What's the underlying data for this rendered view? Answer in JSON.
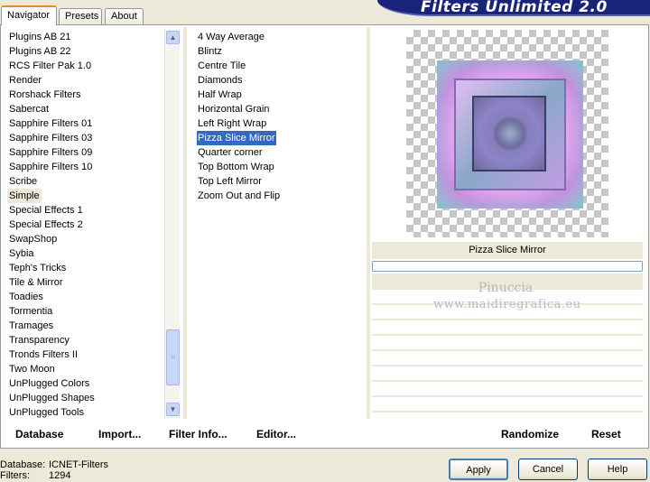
{
  "tabs": [
    "Navigator",
    "Presets",
    "About"
  ],
  "banner_title": "Filters Unlimited 2.0",
  "categories": [
    "Plugins AB 21",
    "Plugins AB 22",
    "RCS Filter Pak 1.0",
    "Render",
    "Rorshack Filters",
    "Sabercat",
    "Sapphire Filters 01",
    "Sapphire Filters 03",
    "Sapphire Filters 09",
    "Sapphire Filters 10",
    "Scribe",
    "Simple",
    "Special Effects 1",
    "Special Effects 2",
    "SwapShop",
    "Sybia",
    "Teph's Tricks",
    "Tile & Mirror",
    "Toadies",
    "Tormentia",
    "Tramages",
    "Transparency",
    "Tronds Filters II",
    "Two Moon",
    "UnPlugged Colors",
    "UnPlugged Shapes",
    "UnPlugged Tools"
  ],
  "selected_category": "Simple",
  "filters": [
    "4 Way Average",
    "Blintz",
    "Centre Tile",
    "Diamonds",
    "Half Wrap",
    "Horizontal Grain",
    "Left Right Wrap",
    "Pizza Slice Mirror",
    "Quarter corner",
    "Top Bottom Wrap",
    "Top Left Mirror",
    "Zoom Out and Flip"
  ],
  "selected_filter": "Pizza Slice Mirror",
  "preview_label": "Pizza Slice Mirror",
  "watermark": {
    "name": "Pinuccia",
    "url": "www.maidiregrafica.eu"
  },
  "bottom_bar": {
    "database": "Database",
    "import": "Import...",
    "filter_info": "Filter Info...",
    "editor": "Editor...",
    "randomize": "Randomize",
    "reset": "Reset"
  },
  "status": {
    "database_label": "Database:",
    "database_value": "ICNET-Filters",
    "filters_label": "Filters:",
    "filters_value": "1294"
  },
  "dialog_buttons": {
    "apply": "Apply",
    "cancel": "Cancel",
    "help": "Help"
  },
  "colors": {
    "selection": "#316ac5",
    "banner": "#1a237a",
    "window": "#ece9d8"
  },
  "icons": {
    "scroll_up": "chevron-up-icon",
    "scroll_down": "chevron-down-icon",
    "thumb": "grip-icon"
  }
}
